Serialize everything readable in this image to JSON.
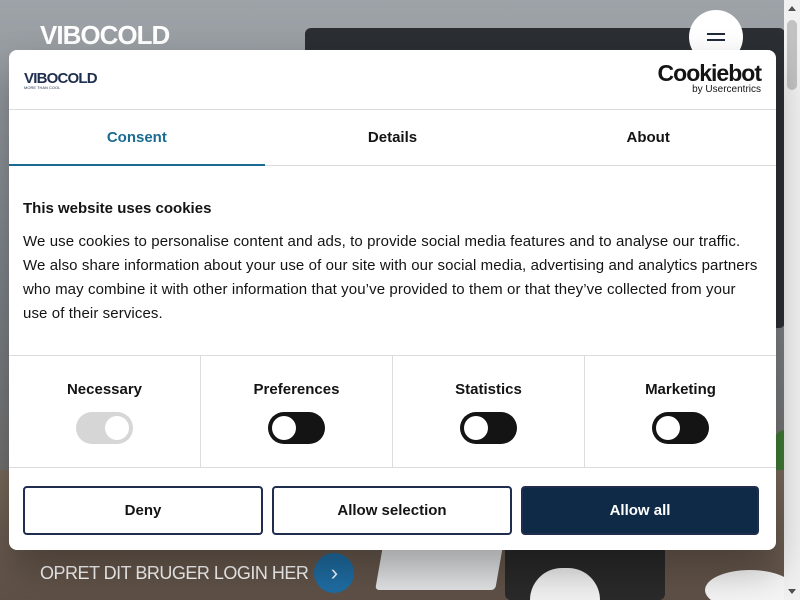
{
  "site": {
    "logo": "VIBOCOLD",
    "menu_icon": "hamburger-icon",
    "cta_text": "OPRET DIT BRUGER LOGIN HER",
    "cta_icon": "chevron-right-icon"
  },
  "dialog": {
    "brand_logo": "VIBOCOLD",
    "brand_tagline": "MORE THAN COOL",
    "cookiebot_name": "Cookiebot",
    "cookiebot_by": "by Usercentrics",
    "tabs": [
      {
        "label": "Consent",
        "active": true
      },
      {
        "label": "Details",
        "active": false
      },
      {
        "label": "About",
        "active": false
      }
    ],
    "heading": "This website uses cookies",
    "body": "We use cookies to personalise content and ads, to provide social media features and to analyse our traffic. We also share information about your use of our site with our social media, advertising and analytics partners who may combine it with other information that you’ve provided to them or that they’ve collected from your use of their services.",
    "toggles": [
      {
        "label": "Necessary",
        "state": "on",
        "disabled": true
      },
      {
        "label": "Preferences",
        "state": "off",
        "disabled": false
      },
      {
        "label": "Statistics",
        "state": "off",
        "disabled": false
      },
      {
        "label": "Marketing",
        "state": "off",
        "disabled": false
      }
    ],
    "buttons": {
      "deny": "Deny",
      "allow_selection": "Allow selection",
      "allow_all": "Allow all"
    }
  },
  "colors": {
    "accent": "#1a6a92",
    "primary_button": "#0e2a47",
    "cta_button": "#1f6ea5"
  }
}
